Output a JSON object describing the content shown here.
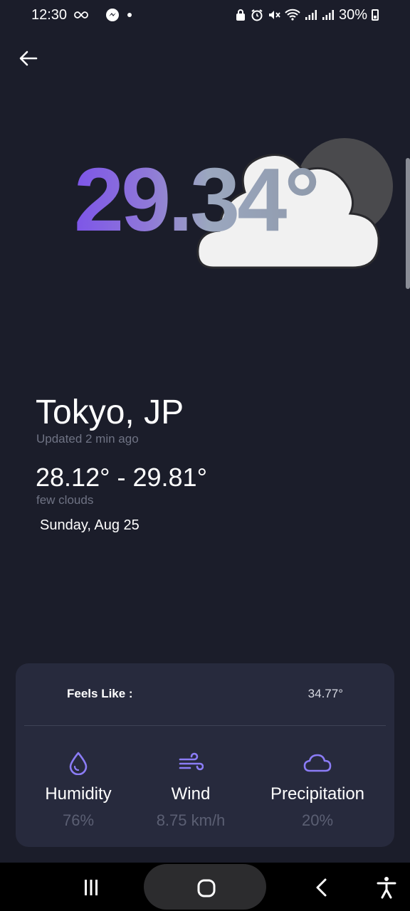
{
  "status_bar": {
    "time": "12:30",
    "battery": "30%",
    "icons": [
      "infinity-icon",
      "messenger-icon",
      "dot-icon",
      "lock-icon",
      "alarm-icon",
      "mute-icon",
      "wifi-icon",
      "signal-icon",
      "signal-icon",
      "battery-icon"
    ]
  },
  "header": {
    "back_icon": "arrow-left-icon"
  },
  "hero": {
    "temperature": "29.34°",
    "icon": "partly-cloudy-icon"
  },
  "location": {
    "city": "Tokyo, JP",
    "updated": "Updated 2 min ago",
    "range": "28.12° - 29.81°",
    "condition": "few clouds",
    "date": "Sunday, Aug 25"
  },
  "details": {
    "feels_like_label": "Feels Like :",
    "feels_like_value": "34.77°",
    "stats": [
      {
        "icon": "droplet-icon",
        "label": "Humidity",
        "value": "76%"
      },
      {
        "icon": "wind-icon",
        "label": "Wind",
        "value": "8.75 km/h"
      },
      {
        "icon": "cloud-icon",
        "label": "Precipitation",
        "value": "20%"
      }
    ]
  },
  "colors": {
    "background": "#1b1d2a",
    "card": "#272a3d",
    "accent": "#8b7cf6",
    "muted_text": "#6f7384"
  },
  "nav_bar": {
    "buttons": [
      "recent-apps-icon",
      "home-icon",
      "back-icon",
      "accessibility-icon"
    ]
  }
}
